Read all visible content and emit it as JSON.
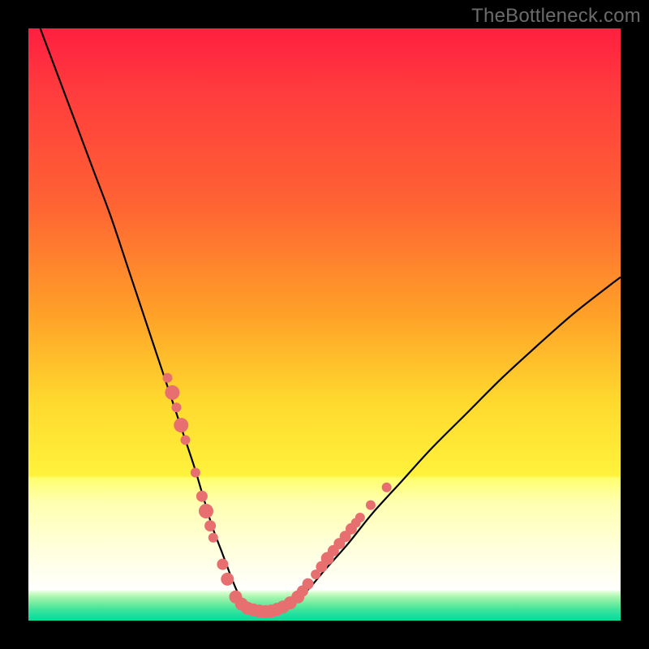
{
  "watermark": "TheBottleneck.com",
  "colors": {
    "curve": "#000000",
    "marker_fill": "#e76f70",
    "marker_stroke": "#d65a5c",
    "bg_top": "#ff1f40",
    "bg_bottom": "#07dd99"
  },
  "chart_data": {
    "type": "line",
    "title": "",
    "xlabel": "",
    "ylabel": "",
    "xlim": [
      0,
      100
    ],
    "ylim": [
      0,
      100
    ],
    "series": [
      {
        "name": "bottleneck-curve",
        "x": [
          2,
          5,
          8,
          11,
          14,
          17,
          20,
          22,
          24,
          26,
          28,
          29.5,
          31,
          32.5,
          34,
          35,
          36,
          37,
          38.5,
          40,
          42,
          44,
          47,
          50,
          54,
          58,
          63,
          68,
          74,
          80,
          86,
          92,
          98,
          100
        ],
        "y": [
          100,
          92,
          84,
          76,
          68,
          59,
          50,
          44,
          38,
          32,
          26,
          21,
          16,
          12,
          8,
          5.5,
          3.5,
          2.4,
          1.7,
          1.5,
          1.8,
          2.8,
          5,
          8.5,
          13,
          18,
          23.5,
          29,
          35,
          41,
          46.5,
          51.8,
          56.5,
          58
        ]
      }
    ],
    "markers": [
      {
        "x": 23.5,
        "y": 41,
        "r": 6
      },
      {
        "x": 24.3,
        "y": 38.5,
        "r": 9
      },
      {
        "x": 25.0,
        "y": 36,
        "r": 6
      },
      {
        "x": 25.8,
        "y": 33,
        "r": 9
      },
      {
        "x": 26.5,
        "y": 30.5,
        "r": 6
      },
      {
        "x": 28.2,
        "y": 25,
        "r": 6
      },
      {
        "x": 29.3,
        "y": 21,
        "r": 7
      },
      {
        "x": 30.0,
        "y": 18.5,
        "r": 9
      },
      {
        "x": 30.7,
        "y": 16,
        "r": 7
      },
      {
        "x": 31.2,
        "y": 14,
        "r": 6
      },
      {
        "x": 32.8,
        "y": 9.5,
        "r": 7
      },
      {
        "x": 33.6,
        "y": 7,
        "r": 8
      },
      {
        "x": 35.0,
        "y": 4,
        "r": 8
      },
      {
        "x": 36.0,
        "y": 2.8,
        "r": 8
      },
      {
        "x": 37.0,
        "y": 2.1,
        "r": 8
      },
      {
        "x": 38.0,
        "y": 1.8,
        "r": 8
      },
      {
        "x": 39.0,
        "y": 1.6,
        "r": 8
      },
      {
        "x": 40.0,
        "y": 1.5,
        "r": 8
      },
      {
        "x": 41.0,
        "y": 1.6,
        "r": 8
      },
      {
        "x": 42.0,
        "y": 1.9,
        "r": 8
      },
      {
        "x": 43.0,
        "y": 2.3,
        "r": 8
      },
      {
        "x": 44.2,
        "y": 3.0,
        "r": 8
      },
      {
        "x": 45.5,
        "y": 4.0,
        "r": 8
      },
      {
        "x": 46.3,
        "y": 5.0,
        "r": 7
      },
      {
        "x": 47.2,
        "y": 6.2,
        "r": 7
      },
      {
        "x": 48.5,
        "y": 7.8,
        "r": 6
      },
      {
        "x": 49.5,
        "y": 9.1,
        "r": 7
      },
      {
        "x": 50.5,
        "y": 10.5,
        "r": 8
      },
      {
        "x": 51.5,
        "y": 11.8,
        "r": 7
      },
      {
        "x": 52.5,
        "y": 13.0,
        "r": 7
      },
      {
        "x": 53.5,
        "y": 14.2,
        "r": 7
      },
      {
        "x": 54.5,
        "y": 15.5,
        "r": 7
      },
      {
        "x": 55.3,
        "y": 16.5,
        "r": 6
      },
      {
        "x": 56.0,
        "y": 17.4,
        "r": 6
      },
      {
        "x": 57.8,
        "y": 19.5,
        "r": 6
      },
      {
        "x": 60.5,
        "y": 22.5,
        "r": 6
      }
    ]
  }
}
